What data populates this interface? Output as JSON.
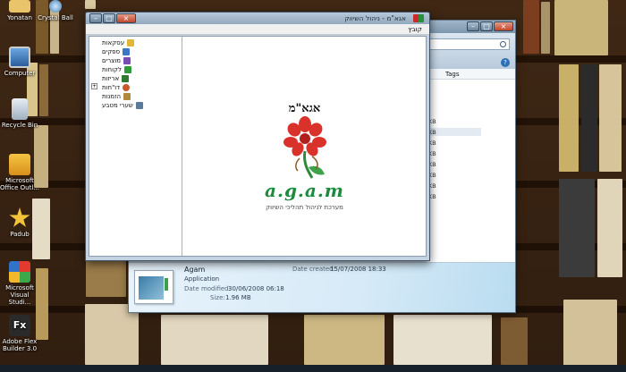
{
  "desktop": {
    "icons": [
      {
        "label": "Yonatan"
      },
      {
        "label": "Crystal Ball"
      },
      {
        "label": "Computer"
      },
      {
        "label": "Recycle Bin"
      },
      {
        "label": "Microsoft Office Outl..."
      },
      {
        "label": "Padub"
      },
      {
        "label": "Microsoft Visual Studi..."
      },
      {
        "label": "Adobe Flex Builder 3.0"
      }
    ]
  },
  "explorer": {
    "column_tags": "Tags",
    "size_values": [
      "KB",
      "KB",
      "KB",
      "KB",
      "KB",
      "KB",
      "KB",
      "KB"
    ],
    "details": {
      "name": "Agam",
      "type": "Application",
      "date_created_label": "Date created:",
      "date_created": "15/07/2008 18:33",
      "date_modified_label": "Date modified:",
      "date_modified": "30/06/2008 06:18",
      "size_label": "Size:",
      "size": "1.96 MB"
    }
  },
  "app": {
    "title": "אגא\"מ - ניהול השיווק",
    "menu_file": "קובץ",
    "tree": [
      {
        "label": "עסקאות",
        "color": "#e2b637"
      },
      {
        "label": "ספקים",
        "color": "#3b78c4"
      },
      {
        "label": "מוצרים",
        "color": "#7a4bb5"
      },
      {
        "label": "לקוחות",
        "color": "#2f9a3a"
      },
      {
        "label": "אריזות",
        "color": "#2f7a30"
      },
      {
        "label": "דו\"חות",
        "color": "#c9582a"
      },
      {
        "label": "הזמנות",
        "color": "#b08a3a"
      },
      {
        "label": "שערי מטבע",
        "color": "#5a7a9a"
      }
    ],
    "logo": {
      "hebrew": "אגא\"מ",
      "latin": "a.g.a.m",
      "subtitle": "מערכת לניהול תהליכי השיווק"
    }
  }
}
